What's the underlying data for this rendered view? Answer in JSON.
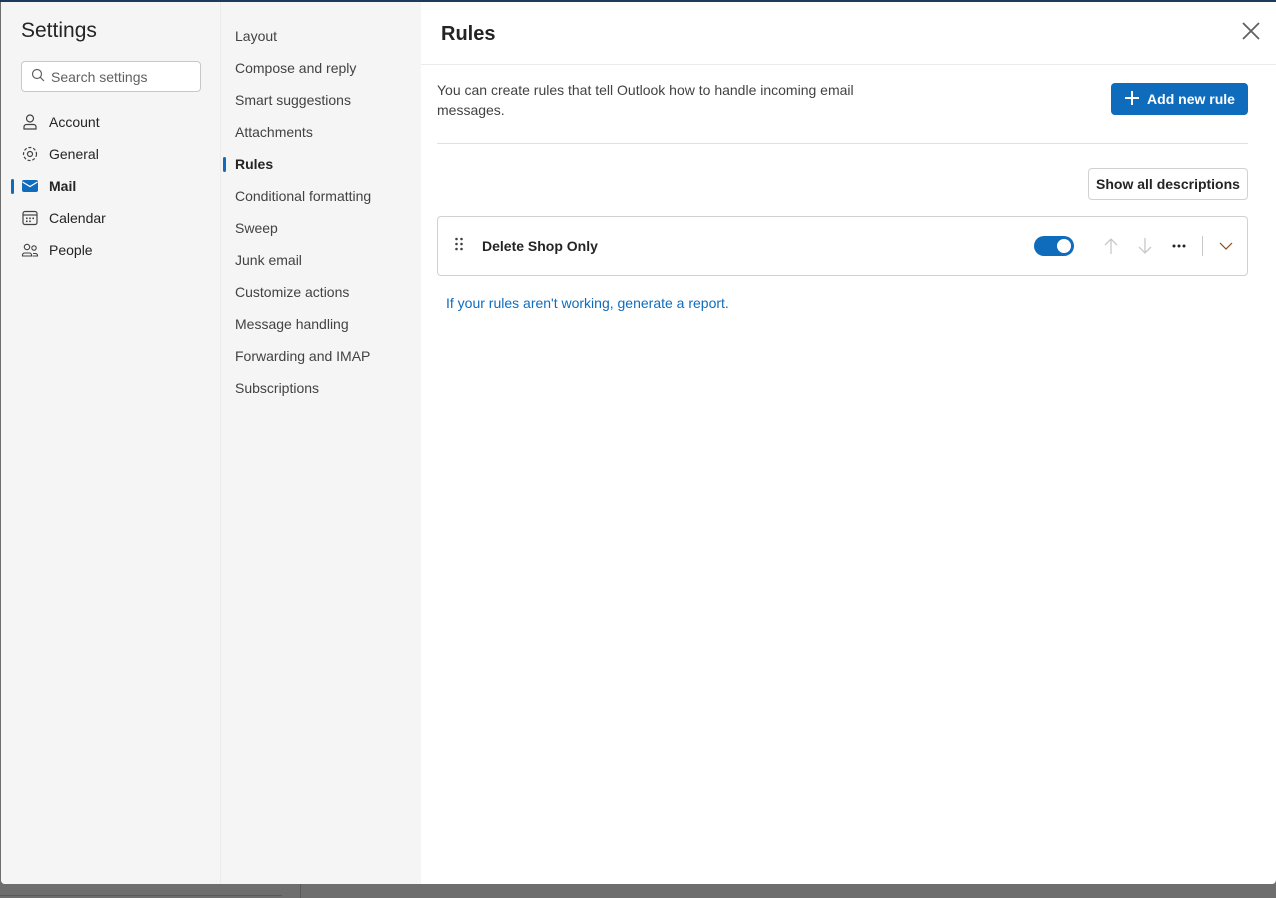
{
  "settings": {
    "title": "Settings",
    "search_placeholder": "Search settings"
  },
  "nav": [
    {
      "label": "Account",
      "icon": "person-icon"
    },
    {
      "label": "General",
      "icon": "gear-icon"
    },
    {
      "label": "Mail",
      "icon": "mail-icon",
      "selected": true
    },
    {
      "label": "Calendar",
      "icon": "calendar-icon"
    },
    {
      "label": "People",
      "icon": "people-icon"
    }
  ],
  "subnav": [
    "Layout",
    "Compose and reply",
    "Smart suggestions",
    "Attachments",
    "Rules",
    "Conditional formatting",
    "Sweep",
    "Junk email",
    "Customize actions",
    "Message handling",
    "Forwarding and IMAP",
    "Subscriptions"
  ],
  "subnav_selected": "Rules",
  "main": {
    "title": "Rules",
    "description": "You can create rules that tell Outlook how to handle incoming email messages.",
    "add_rule_label": "Add new rule",
    "show_all_label": "Show all descriptions",
    "rules": [
      {
        "name": "Delete Shop Only",
        "enabled": true
      }
    ],
    "report_link": "If your rules aren't working, generate a report."
  },
  "colors": {
    "accent": "#0f6cbd"
  }
}
